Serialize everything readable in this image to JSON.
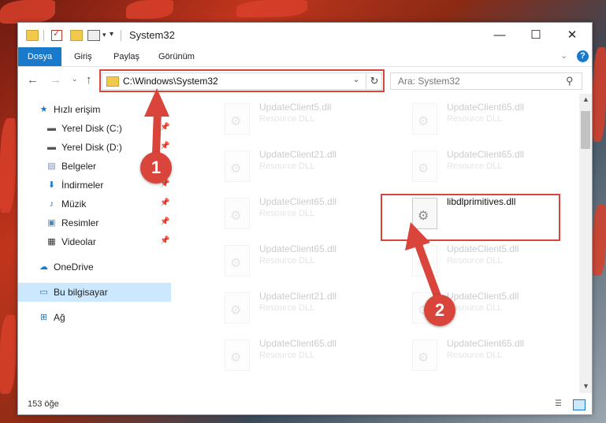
{
  "window": {
    "title": "System32",
    "min_glyph": "—",
    "max_glyph": "☐",
    "close_glyph": "✕"
  },
  "ribbon": {
    "tabs": [
      "Dosya",
      "Giriş",
      "Paylaş",
      "Görünüm"
    ],
    "expand_glyph": "⌄",
    "help_glyph": "?"
  },
  "navigation": {
    "back_glyph": "←",
    "forward_glyph": "→",
    "recent_glyph": "⌄",
    "up_glyph": "↑",
    "address": "C:\\Windows\\System32",
    "address_dropdown_glyph": "⌄",
    "refresh_glyph": "↻",
    "search_placeholder": "Ara: System32",
    "search_glyph": "⚲"
  },
  "sidebar": {
    "pin_glyph": "📌",
    "items": [
      {
        "label": "Hızlı erişim",
        "icon": "star-icon",
        "glyph": "★",
        "color": "#1979ca",
        "pinned": false
      },
      {
        "label": "Yerel Disk (C:)",
        "icon": "drive-icon",
        "glyph": "▬",
        "color": "#555555",
        "pinned": true
      },
      {
        "label": "Yerel Disk (D:)",
        "icon": "drive-icon",
        "glyph": "▬",
        "color": "#555555",
        "pinned": true
      },
      {
        "label": "Belgeler",
        "icon": "documents-icon",
        "glyph": "▤",
        "color": "#6b8fb3",
        "pinned": true
      },
      {
        "label": "İndirmeler",
        "icon": "download-icon",
        "glyph": "⬇",
        "color": "#1979ca",
        "pinned": true
      },
      {
        "label": "Müzik",
        "icon": "music-icon",
        "glyph": "♪",
        "color": "#1979ca",
        "pinned": true
      },
      {
        "label": "Resimler",
        "icon": "pictures-icon",
        "glyph": "▣",
        "color": "#4a8ab8",
        "pinned": true
      },
      {
        "label": "Videolar",
        "icon": "videos-icon",
        "glyph": "▦",
        "color": "#333333",
        "pinned": true
      },
      {
        "label": "OneDrive",
        "icon": "cloud-icon",
        "glyph": "☁",
        "color": "#1979ca",
        "pinned": false
      },
      {
        "label": "Bu bilgisayar",
        "icon": "computer-icon",
        "glyph": "▭",
        "color": "#1979ca",
        "pinned": false,
        "selected": true
      },
      {
        "label": "Ağ",
        "icon": "network-icon",
        "glyph": "⊞",
        "color": "#1979ca",
        "pinned": false
      }
    ]
  },
  "files": [
    {
      "name": "UpdateClient5.dll",
      "type": "Resource DLL",
      "faded": true
    },
    {
      "name": "UpdateClient65.dll",
      "type": "Resource DLL",
      "faded": true
    },
    {
      "name": "UpdateClient21.dll",
      "type": "Resource DLL",
      "faded": true
    },
    {
      "name": "UpdateClient65.dll",
      "type": "Resource DLL",
      "faded": true
    },
    {
      "name": "UpdateClient65.dll",
      "type": "Resource DLL",
      "faded": true
    },
    {
      "name": "libdlprimitives.dll",
      "type": "",
      "faded": false
    },
    {
      "name": "UpdateClient65.dll",
      "type": "Resource DLL",
      "faded": true
    },
    {
      "name": "UpdateClient5.dll",
      "type": "Resource DLL",
      "faded": true
    },
    {
      "name": "UpdateClient21.dll",
      "type": "Resource DLL",
      "faded": true
    },
    {
      "name": "UpdateClient5.dll",
      "type": "Resource DLL",
      "faded": true
    },
    {
      "name": "UpdateClient65.dll",
      "type": "Resource DLL",
      "faded": true
    },
    {
      "name": "UpdateClient65.dll",
      "type": "Resource DLL",
      "faded": true
    }
  ],
  "status": {
    "item_count": "153 öğe"
  },
  "annotations": [
    {
      "number": "1"
    },
    {
      "number": "2"
    }
  ],
  "colors": {
    "accent": "#1979ca",
    "highlight": "#d9453a",
    "selection": "#cce8ff"
  }
}
